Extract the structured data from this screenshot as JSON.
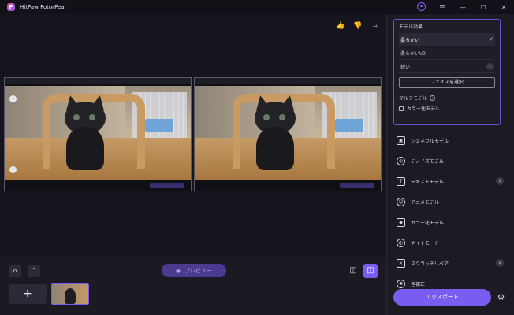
{
  "app": {
    "title": "HitPaw FotorPea",
    "logo_letter": "P"
  },
  "window_controls": {
    "menu": "☰",
    "minimize": "—",
    "maximize": "☐",
    "close": "✕"
  },
  "toolbar": {
    "like": "👍",
    "dislike": "👎",
    "crop": "⌗"
  },
  "zoom": {
    "in": "+",
    "out": "−"
  },
  "bottom": {
    "home": "⌂",
    "up": "⌃",
    "preview_label": "プレビュー",
    "preview_icon": "◉",
    "view_split": "◫",
    "view_compare": "◫",
    "add": "+"
  },
  "model_card": {
    "title": "モデル効果",
    "options": [
      {
        "label": "柔らかい",
        "mark": "✓"
      },
      {
        "label": "柔らかいV2",
        "mark": ""
      },
      {
        "label": "鋭い",
        "mark": "↓"
      }
    ],
    "face_button": "フェイスを選択",
    "multi_label": "マルチモデル",
    "multi_info": "i",
    "multi_checkbox_label": "カラー化モデル"
  },
  "models": [
    {
      "label": "ジェネラルモデル",
      "icon": "▣",
      "download": ""
    },
    {
      "label": "デノイズモデル",
      "icon": "◎",
      "download": ""
    },
    {
      "label": "テキストモデル",
      "icon": "T",
      "download": "↓"
    },
    {
      "label": "アニメモデル",
      "icon": "☺",
      "download": ""
    },
    {
      "label": "カラー化モデル",
      "icon": "◆",
      "download": ""
    },
    {
      "label": "ナイトモード",
      "icon": "◐",
      "download": ""
    },
    {
      "label": "スクラッチリペア",
      "icon": "✕",
      "download": "↓"
    },
    {
      "label": "色補正",
      "icon": "✺",
      "download": ""
    }
  ],
  "export_label": "エクスポート",
  "settings_icon": "⚙"
}
